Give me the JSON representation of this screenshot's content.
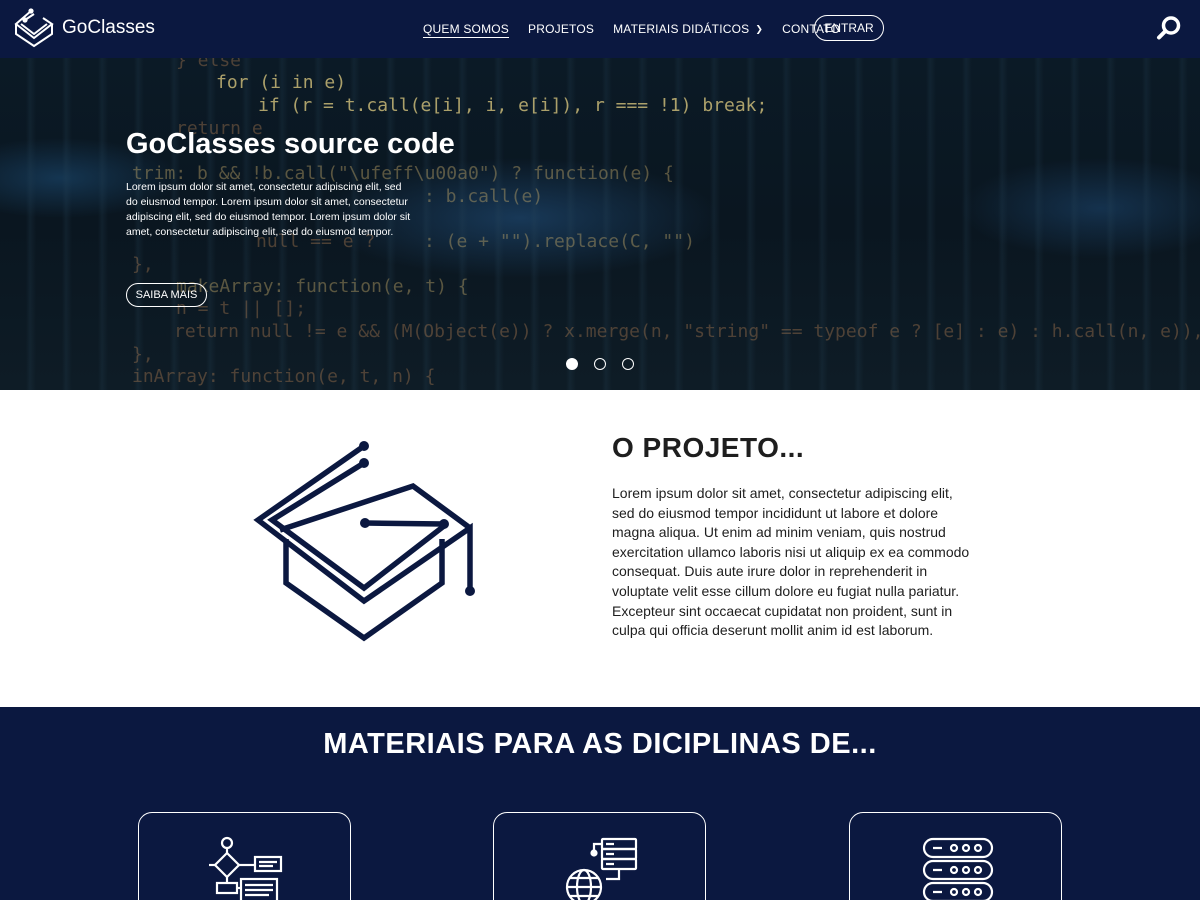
{
  "brand": {
    "name": "GoClasses",
    "logo_icon": "graduation-cap-logo"
  },
  "nav": {
    "items": [
      {
        "label": "QUEM SOMOS",
        "active": true
      },
      {
        "label": "PROJETOS"
      },
      {
        "label": "MATERIAIS DIDÁTICOS",
        "has_dropdown": true
      },
      {
        "label": "CONTATO"
      }
    ],
    "login_label": "ENTRAR",
    "search_icon": "search-icon"
  },
  "hero": {
    "title": "GoClasses source code",
    "text": "Lorem ipsum dolor sit amet, consectetur adipiscing elit, sed do eiusmod tempor. Lorem ipsum dolor sit amet, consectetur adipiscing elit, sed do eiusmod tempor. Lorem ipsum dolor sit amet, consectetur adipiscing elit, sed do eiusmod tempor.",
    "button_label": "SAIBA MAIS",
    "slides": 3,
    "active_slide": 1,
    "background_code": [
      "} else",
      "for (i in e)",
      "if (r = t.call(e[i], i, e[i]), r === !1) break;",
      "return e",
      "trim: b && !b.call(\"\\ufeff\\u00a0\") ? function(e) {",
      ": b.call(e)",
      ": (e + \"\").replace(C, \"\")",
      "null == e ?",
      "},",
      "makeArray: function(e, t) {",
      "n = t || [];",
      "return null != e && (M(Object(e)) ? x.merge(n, \"string\" == typeof e ? [e] : e) : h.call(n, e)), n",
      "},",
      "inArray: function(e, t, n) {"
    ]
  },
  "project": {
    "title": "O PROJETO...",
    "text": "Lorem ipsum dolor sit amet, consectetur adipiscing elit, sed do eiusmod tempor incididunt ut labore et dolore magna aliqua. Ut enim ad minim veniam, quis nostrud exercitation ullamco laboris nisi ut aliquip ex ea commodo consequat. Duis aute irure dolor in reprehenderit in voluptate velit esse cillum dolore eu fugiat nulla pariatur. Excepteur sint occaecat cupidatat non proident, sunt in culpa qui officia deserunt mollit anim id est laborum.",
    "icon": "graduation-cap-circuit-icon"
  },
  "materials": {
    "title": "MATERIAIS PARA AS DICIPLINAS DE...",
    "cards": [
      {
        "icon": "flowchart-icon"
      },
      {
        "icon": "globe-database-icon"
      },
      {
        "icon": "server-icon"
      }
    ]
  },
  "colors": {
    "navy": "#0b1840",
    "white": "#ffffff",
    "text_dark": "#1e1e1e"
  }
}
